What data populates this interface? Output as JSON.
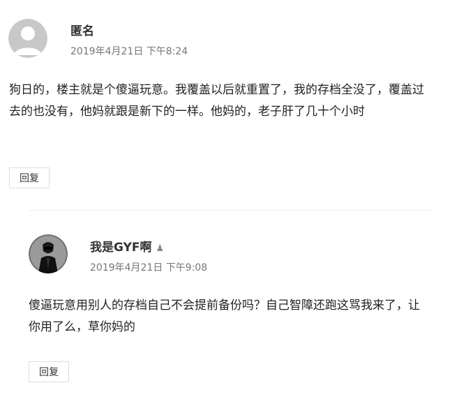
{
  "comments": [
    {
      "author": "匿名",
      "date": "2019年4月21日 下午8:24",
      "text": "狗日的，楼主就是个傻逼玩意。我覆盖以后就重置了，我的存档全没了，覆盖过去的也没有，他妈就跟是新下的一样。他妈的，老子肝了几十个小时",
      "reply_label": "回复",
      "avatar_icon": "default-user-avatar-icon"
    },
    {
      "author": "我是GYF啊",
      "author_badge": "author-person-icon",
      "date": "2019年4月21日 下午9:08",
      "text": "傻逼玩意用别人的存档自己不会提前备份吗？自己智障还跑这骂我来了，让你用了么，草你妈的",
      "reply_label": "回复",
      "avatar_icon": "dark-character-avatar-icon"
    }
  ],
  "colors": {
    "text": "#222222",
    "meta": "#767676",
    "border": "#dddddd",
    "divider": "#eeeeee"
  }
}
